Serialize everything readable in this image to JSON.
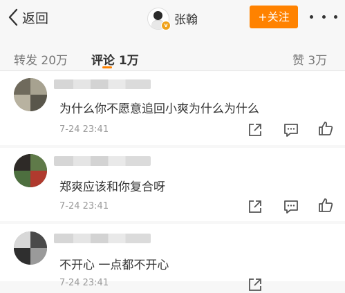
{
  "nav": {
    "back_label": "返回",
    "user_name": "张翰",
    "follow_label": "+关注"
  },
  "tabs": {
    "repost": "转发 20万",
    "comments": "评论 1万",
    "likes": "赞 3万"
  },
  "comments": [
    {
      "text": "为什么你不愿意追回小爽为什么为什么",
      "time": "7-24 23:41"
    },
    {
      "text": "郑爽应该和你复合呀",
      "time": "7-24 23:41"
    },
    {
      "text": "不开心 一点都不开心",
      "time": "7-24 23:41"
    }
  ],
  "colors": {
    "accent": "#ff8200",
    "text": "#333333",
    "muted": "#999999",
    "background": "#f7f7f7"
  },
  "icons": {
    "back": "chevron-left-icon",
    "more": "more-dots-icon",
    "share": "share-icon",
    "comment": "comment-icon",
    "like": "thumbs-up-icon"
  }
}
